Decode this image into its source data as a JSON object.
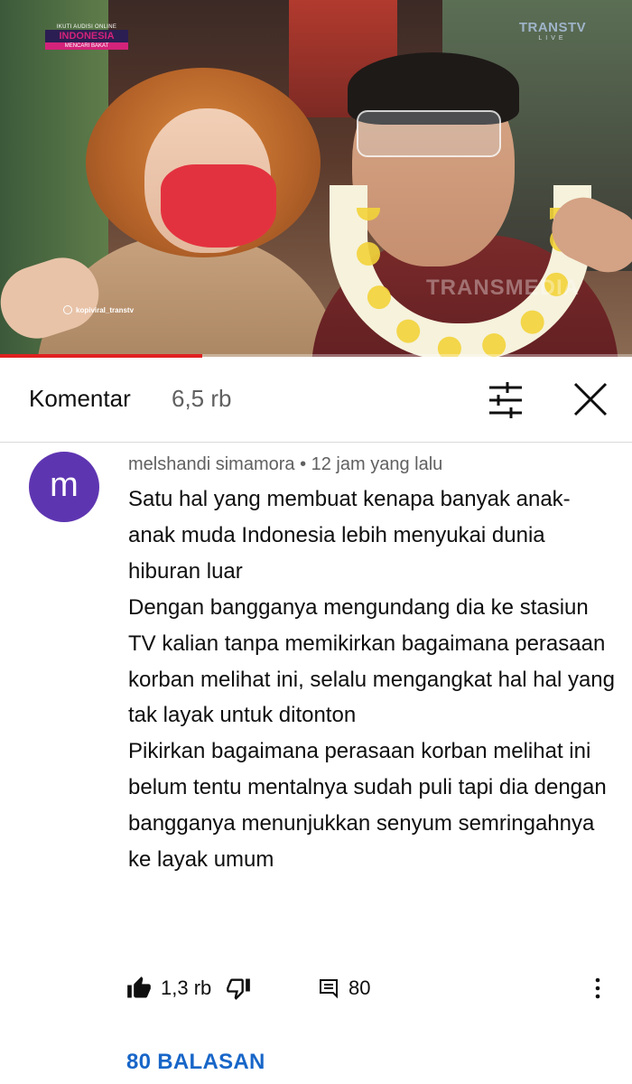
{
  "video": {
    "overlay_left": {
      "line1": "IKUTI AUDISI ONLINE",
      "line2": "INDONESIA",
      "line3": "MENCARI BAKAT"
    },
    "overlay_right": {
      "brand": "TRANSTV",
      "live": "LIVE"
    },
    "watermark": "TRANSMEDIA",
    "instagram_tag": "kopiviral_transtv",
    "progress_fraction": 0.32,
    "progress_color": "#e02020"
  },
  "comments_header": {
    "title": "Komentar",
    "count": "6,5 rb",
    "sort_icon": "sliders-icon",
    "close_icon": "close-icon"
  },
  "comment": {
    "avatar_letter": "m",
    "avatar_color": "#5e35b1",
    "meta": "melshandi simamora • 12 jam yang lalu",
    "text": "Satu hal yang membuat kenapa banyak anak-anak muda Indonesia lebih menyukai dunia hiburan luar\nDengan bangganya mengundang dia ke stasiun TV kalian tanpa memikirkan bagaimana perasaan korban melihat ini, selalu mengangkat hal hal yang tak layak untuk ditonton\nPikirkan bagaimana perasaan korban melihat ini belum tentu mentalnya sudah puli tapi dia dengan bangganya menunjukkan senyum semringahnya ke layak umum",
    "likes": "1,3 rb",
    "reply_count": "80",
    "replies_link": "80 BALASAN",
    "link_color": "#1866c8"
  }
}
